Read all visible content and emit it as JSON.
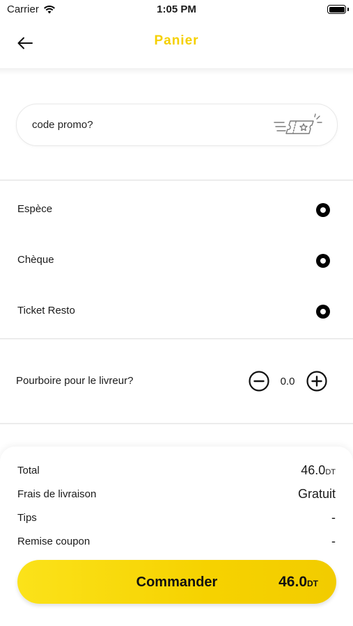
{
  "status_bar": {
    "carrier": "Carrier",
    "time": "1:05 PM"
  },
  "header": {
    "title": "Panier",
    "title_color": "#f5d000"
  },
  "promo": {
    "placeholder": "code promo?"
  },
  "payment": {
    "options": [
      {
        "label": "Espèce"
      },
      {
        "label": "Chèque"
      },
      {
        "label": "Ticket Resto"
      }
    ]
  },
  "tip": {
    "label": "Pourboire pour le livreur?",
    "value": "0.0"
  },
  "summary": {
    "rows": [
      {
        "label": "Total",
        "value": "46.0",
        "unit": "DT"
      },
      {
        "label": "Frais de livraison",
        "value": "Gratuit",
        "unit": ""
      },
      {
        "label": "Tips",
        "value": "-",
        "unit": ""
      },
      {
        "label": "Remise coupon",
        "value": "-",
        "unit": ""
      }
    ]
  },
  "order_button": {
    "label": "Commander",
    "price": "46.0",
    "unit": "DT",
    "color": "#f6d200"
  }
}
